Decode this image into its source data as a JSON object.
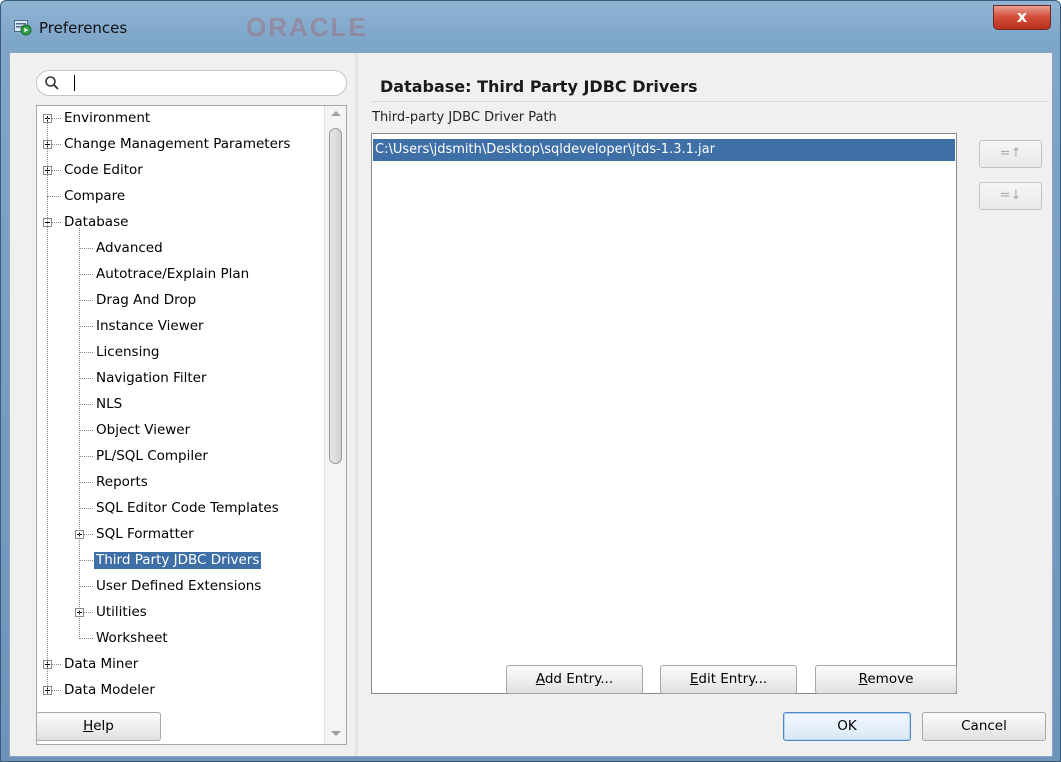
{
  "window": {
    "title": "Preferences",
    "close_label": "x",
    "watermark": "ORACLE"
  },
  "search": {
    "value": "",
    "placeholder": ""
  },
  "tree": {
    "items": [
      {
        "label": "Environment",
        "level": 0,
        "expander": "plus"
      },
      {
        "label": "Change Management Parameters",
        "level": 0,
        "expander": "plus"
      },
      {
        "label": "Code Editor",
        "level": 0,
        "expander": "plus"
      },
      {
        "label": "Compare",
        "level": 0,
        "expander": "none"
      },
      {
        "label": "Database",
        "level": 0,
        "expander": "minus"
      },
      {
        "label": "Advanced",
        "level": 1,
        "expander": "none"
      },
      {
        "label": "Autotrace/Explain Plan",
        "level": 1,
        "expander": "none"
      },
      {
        "label": "Drag And Drop",
        "level": 1,
        "expander": "none"
      },
      {
        "label": "Instance Viewer",
        "level": 1,
        "expander": "none"
      },
      {
        "label": "Licensing",
        "level": 1,
        "expander": "none"
      },
      {
        "label": "Navigation Filter",
        "level": 1,
        "expander": "none"
      },
      {
        "label": "NLS",
        "level": 1,
        "expander": "none"
      },
      {
        "label": "Object Viewer",
        "level": 1,
        "expander": "none"
      },
      {
        "label": "PL/SQL Compiler",
        "level": 1,
        "expander": "none"
      },
      {
        "label": "Reports",
        "level": 1,
        "expander": "none"
      },
      {
        "label": "SQL Editor Code Templates",
        "level": 1,
        "expander": "none"
      },
      {
        "label": "SQL Formatter",
        "level": 1,
        "expander": "plus"
      },
      {
        "label": "Third Party JDBC Drivers",
        "level": 1,
        "expander": "none",
        "selected": true
      },
      {
        "label": "User Defined Extensions",
        "level": 1,
        "expander": "none"
      },
      {
        "label": "Utilities",
        "level": 1,
        "expander": "plus"
      },
      {
        "label": "Worksheet",
        "level": 1,
        "expander": "none"
      },
      {
        "label": "Data Miner",
        "level": 0,
        "expander": "plus"
      },
      {
        "label": "Data Modeler",
        "level": 0,
        "expander": "plus"
      }
    ]
  },
  "page": {
    "title": "Database: Third Party JDBC Drivers",
    "path_label": "Third-party JDBC Driver Path",
    "entries": [
      "C:\\Users\\jdsmith\\Desktop\\sqldeveloper\\jtds-1.3.1.jar"
    ],
    "move_up_label": "=↑",
    "move_down_label": "=↓"
  },
  "buttons": {
    "add_entry": {
      "pre": "",
      "mnemonic": "A",
      "post": "dd Entry..."
    },
    "edit_entry": {
      "pre": "",
      "mnemonic": "E",
      "post": "dit Entry..."
    },
    "remove": {
      "pre": "",
      "mnemonic": "R",
      "post": "emove"
    },
    "help": {
      "pre": "",
      "mnemonic": "H",
      "post": "elp"
    },
    "ok": "OK",
    "cancel": "Cancel"
  },
  "colors": {
    "selection": "#3e6fa6",
    "title_bar": "#7ea6c9",
    "close_button": "#c7432e"
  }
}
